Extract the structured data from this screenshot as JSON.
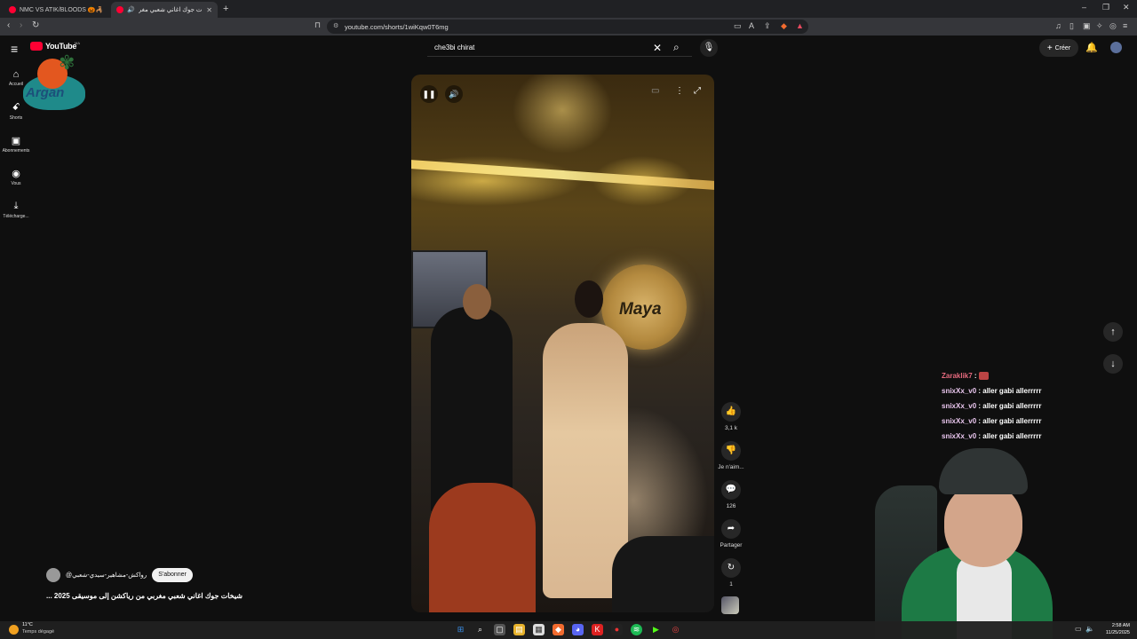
{
  "browser": {
    "tabs": [
      {
        "label": "NMC VS ATIK/BLOODS 🎃🦂 - YouTube",
        "active": false
      },
      {
        "label": "شيخات جوك اغاني شعبي مغر...",
        "active": true
      }
    ],
    "url": "youtube.com/shorts/1wiKqw0T6mg"
  },
  "youtube": {
    "logo_text": "YouTube",
    "logo_super": "MA",
    "brand_overlay": "Argan",
    "search_value": "che3bi chirat",
    "create_label": "Créer",
    "nav": [
      {
        "icon": "home-icon",
        "label": "Accueil"
      },
      {
        "icon": "shorts-icon",
        "label": "Shorts"
      },
      {
        "icon": "subscriptions-icon",
        "label": "Abonnements"
      },
      {
        "icon": "you-icon",
        "label": "Vous"
      },
      {
        "icon": "download-icon",
        "label": "Télécharge..."
      }
    ]
  },
  "short": {
    "sign_text": "Maya",
    "channel_name": "@رواكش-مشاهير-سيدي-شعبي",
    "subscribe_label": "S'abonner",
    "title": "شيخات جوك اغاني شعبي مغربي من رياكشن إلى موسيقى 2025 ...",
    "actions": {
      "likes": "3,1 k",
      "dislike_label": "Je n'aim...",
      "comments": "126",
      "share_label": "Partager",
      "remix_count": "1"
    }
  },
  "chat": [
    {
      "user": "Zaraklik7",
      "message": ""
    },
    {
      "user": "snixXx_v0",
      "message": "aller gabi allerrrrr"
    },
    {
      "user": "snixXx_v0",
      "message": "aller gabi allerrrrr"
    },
    {
      "user": "snixXx_v0",
      "message": "aller gabi allerrrrr"
    },
    {
      "user": "snixXx_v0",
      "message": "aller gabi allerrrrr"
    }
  ],
  "taskbar": {
    "weather_temp": "11°C",
    "weather_desc": "Temps dégagé",
    "time": "2:58 AM",
    "date": "11/25/2025"
  },
  "colors": {
    "accent": "#ff0033",
    "background": "#0f0f0f",
    "chat_user": "#e9c6ee",
    "chat_first_user": "#e66a7e"
  }
}
